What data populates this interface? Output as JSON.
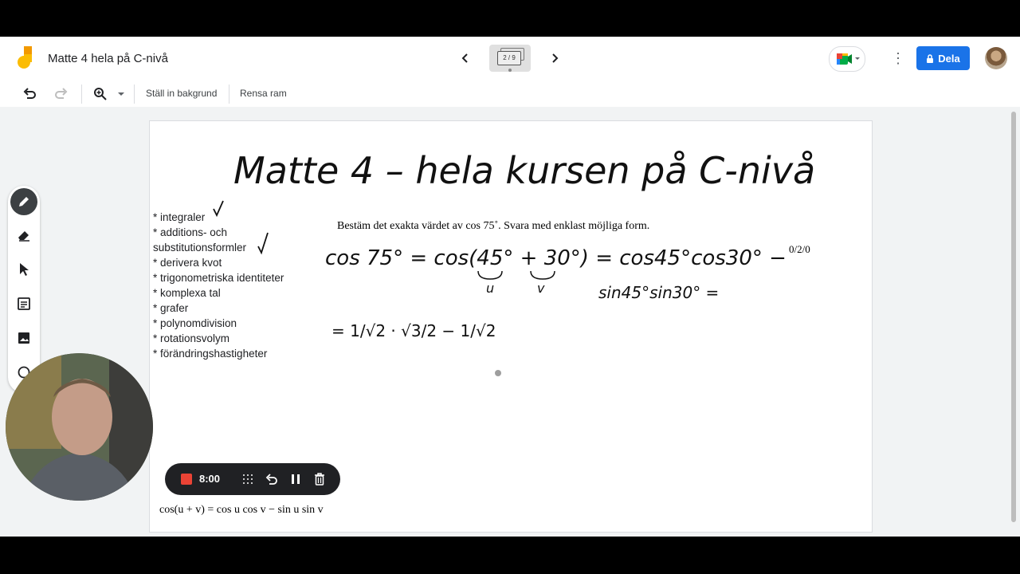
{
  "header": {
    "title": "Matte 4 hela på C-nivå",
    "frame_indicator": "2 / 9",
    "share_label": "Dela"
  },
  "toolbar": {
    "set_background": "Ställ in bakgrund",
    "clear_frame": "Rensa ram"
  },
  "canvas": {
    "heading": "Matte 4 – hela kursen på C-nivå",
    "topics": [
      "* integraler",
      "* additions- och",
      "substitutionsformler",
      "* derivera kvot",
      "* trigonometriska identiteter",
      "* komplexa tal",
      "* grafer",
      "* polynomdivision",
      "* rotationsvolym",
      "* förändringshastigheter"
    ],
    "problem": "Bestäm det exakta värdet av cos 75˚. Svara med enklast möjliga form.",
    "score": "0/2/0",
    "handwritten": {
      "line1": "cos 75° = cos(45° + 30°) = cos45°cos30° −",
      "line2": "sin45°sin30° =",
      "labels": [
        "u",
        "v"
      ],
      "line3": "= 1/√2 · √3/2 − 1/√2"
    },
    "formula": "cos(u + v) = cos u cos v − sin u sin v"
  },
  "recording": {
    "time": "8:00"
  },
  "icons": {
    "undo": "undo-icon",
    "redo": "redo-icon",
    "zoom": "zoom-icon",
    "pen": "pen-icon",
    "eraser": "eraser-icon",
    "pointer": "pointer-icon",
    "sticky_note": "sticky-note-icon",
    "image": "image-icon",
    "circle": "circle-icon"
  },
  "colors": {
    "share_button": "#1a73e8",
    "record_stop": "#ea4335",
    "logo_yellow": "#fbbc04",
    "logo_orange": "#f29900"
  }
}
